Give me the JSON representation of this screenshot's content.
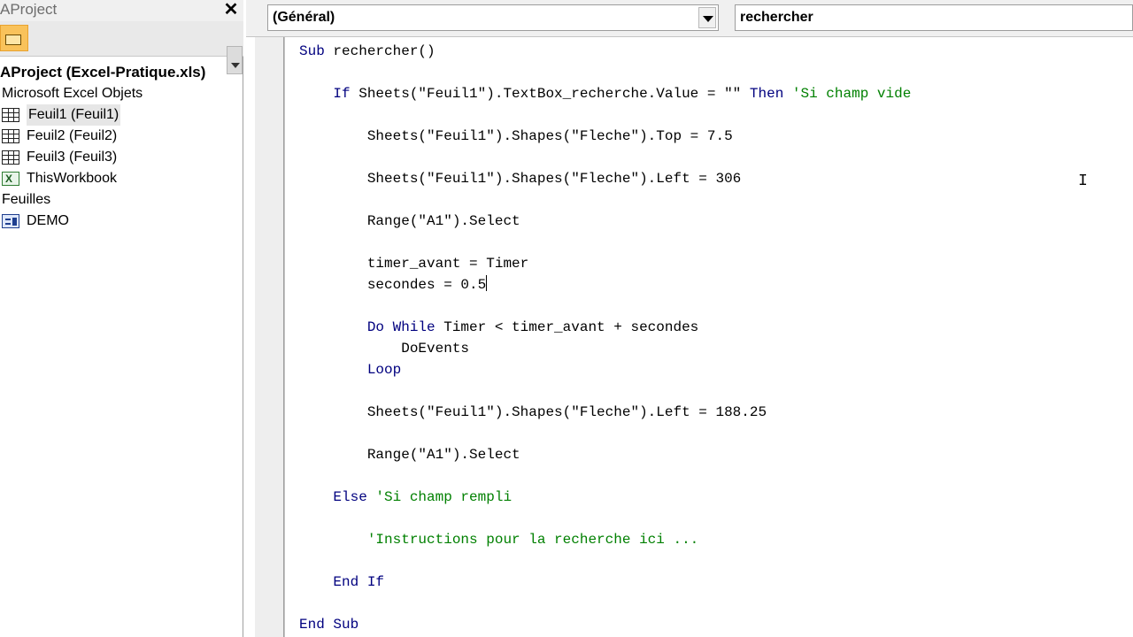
{
  "project_pane": {
    "title": "AProject",
    "close_glyph": "✕",
    "toolbar": {
      "toggle_folders_icon": "folder-icon"
    },
    "tree": [
      {
        "kind": "root",
        "label": "AProject (Excel-Pratique.xls)"
      },
      {
        "kind": "folder",
        "label": "Microsoft Excel Objets"
      },
      {
        "kind": "leaf",
        "icon": "worksheet-icon",
        "label": "Feuil1 (Feuil1)",
        "selected": true
      },
      {
        "kind": "leaf",
        "icon": "worksheet-icon",
        "label": "Feuil2 (Feuil2)"
      },
      {
        "kind": "leaf",
        "icon": "worksheet-icon",
        "label": "Feuil3 (Feuil3)"
      },
      {
        "kind": "leaf",
        "icon": "workbook-icon",
        "label": "ThisWorkbook"
      },
      {
        "kind": "folder",
        "label": "Feuilles"
      },
      {
        "kind": "leaf",
        "icon": "userform-icon",
        "label": "DEMO"
      }
    ]
  },
  "code_window": {
    "object_combo": "(Général)",
    "procedure_combo": "rechercher",
    "colors": {
      "keyword": "#00007f",
      "comment": "#008000",
      "text": "#000000"
    },
    "lines": [
      [
        {
          "t": "Sub",
          "k": "kw"
        },
        {
          "t": " rechercher()"
        }
      ],
      [],
      [
        {
          "t": "    "
        },
        {
          "t": "If",
          "k": "kw"
        },
        {
          "t": " Sheets(\"Feuil1\").TextBox_recherche.Value = \"\" "
        },
        {
          "t": "Then",
          "k": "kw"
        },
        {
          "t": " 'Si champ vide",
          "k": "cmt"
        }
      ],
      [],
      [
        {
          "t": "        Sheets(\"Feuil1\").Shapes(\"Fleche\").Top = 7.5"
        }
      ],
      [],
      [
        {
          "t": "        Sheets(\"Feuil1\").Shapes(\"Fleche\").Left = 306"
        }
      ],
      [],
      [
        {
          "t": "        Range(\"A1\").Select"
        }
      ],
      [],
      [
        {
          "t": "        timer_avant = Timer"
        }
      ],
      [
        {
          "t": "        secondes = 0.5"
        },
        {
          "caret": true
        }
      ],
      [],
      [
        {
          "t": "        "
        },
        {
          "t": "Do While",
          "k": "kw"
        },
        {
          "t": " Timer < timer_avant + secondes"
        }
      ],
      [
        {
          "t": "            DoEvents"
        }
      ],
      [
        {
          "t": "        "
        },
        {
          "t": "Loop",
          "k": "kw"
        }
      ],
      [],
      [
        {
          "t": "        Sheets(\"Feuil1\").Shapes(\"Fleche\").Left = 188.25"
        }
      ],
      [],
      [
        {
          "t": "        Range(\"A1\").Select"
        }
      ],
      [],
      [
        {
          "t": "    "
        },
        {
          "t": "Else",
          "k": "kw"
        },
        {
          "t": " 'Si champ rempli",
          "k": "cmt"
        }
      ],
      [],
      [
        {
          "t": "        'Instructions pour la recherche ici ...",
          "k": "cmt"
        }
      ],
      [],
      [
        {
          "t": "    "
        },
        {
          "t": "End If",
          "k": "kw"
        }
      ],
      [],
      [
        {
          "t": "End Sub",
          "k": "kw"
        }
      ]
    ]
  }
}
